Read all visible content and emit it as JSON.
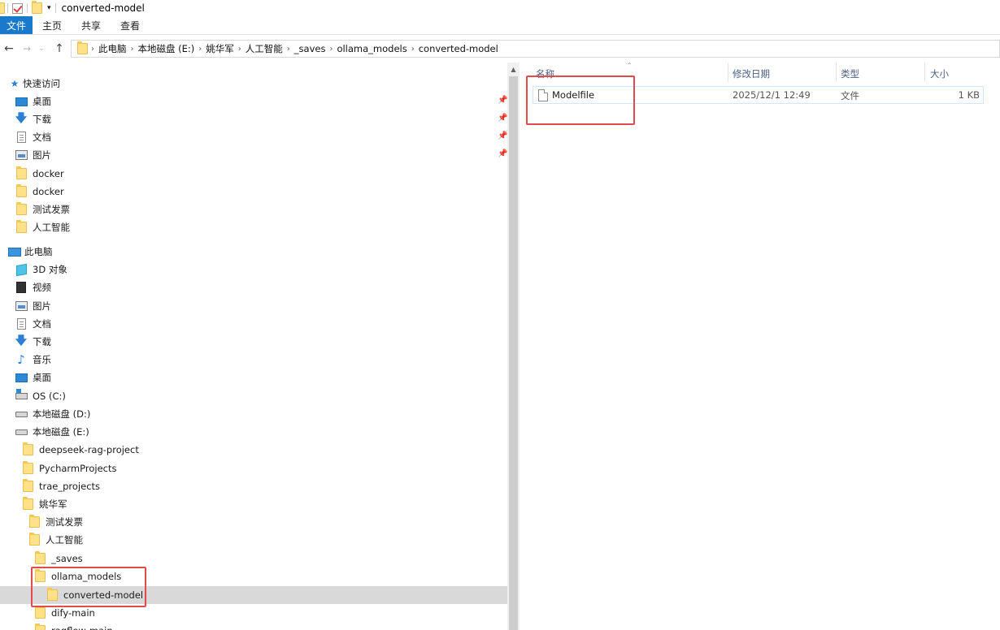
{
  "window": {
    "title": "converted-model"
  },
  "ribbon": {
    "tabs": [
      "文件",
      "主页",
      "共享",
      "查看"
    ]
  },
  "address": {
    "crumbs": [
      "此电脑",
      "本地磁盘 (E:)",
      "姚华军",
      "人工智能",
      "_saves",
      "ollama_models",
      "converted-model"
    ]
  },
  "nav": {
    "quick_access": "快速访问",
    "quick_items": [
      "桌面",
      "下载",
      "文档",
      "图片",
      "docker",
      "docker",
      "测试发票",
      "人工智能"
    ],
    "this_pc": "此电脑",
    "pc_items": [
      "3D 对象",
      "视频",
      "图片",
      "文档",
      "下载",
      "音乐",
      "桌面",
      "OS (C:)",
      "本地磁盘 (D:)",
      "本地磁盘 (E:)"
    ],
    "tree_items": [
      "deepseek-rag-project",
      "PycharmProjects",
      "trae_projects",
      "姚华军",
      "测试发票",
      "人工智能",
      "_saves",
      "ollama_models",
      "converted-model",
      "dify-main",
      "ragflow-main"
    ]
  },
  "content": {
    "columns": {
      "name": "名称",
      "modified": "修改日期",
      "type": "类型",
      "size": "大小"
    },
    "files": [
      {
        "name": "Modelfile",
        "modified": "2025/12/1 12:49",
        "type": "文件",
        "size": "1 KB"
      }
    ]
  }
}
